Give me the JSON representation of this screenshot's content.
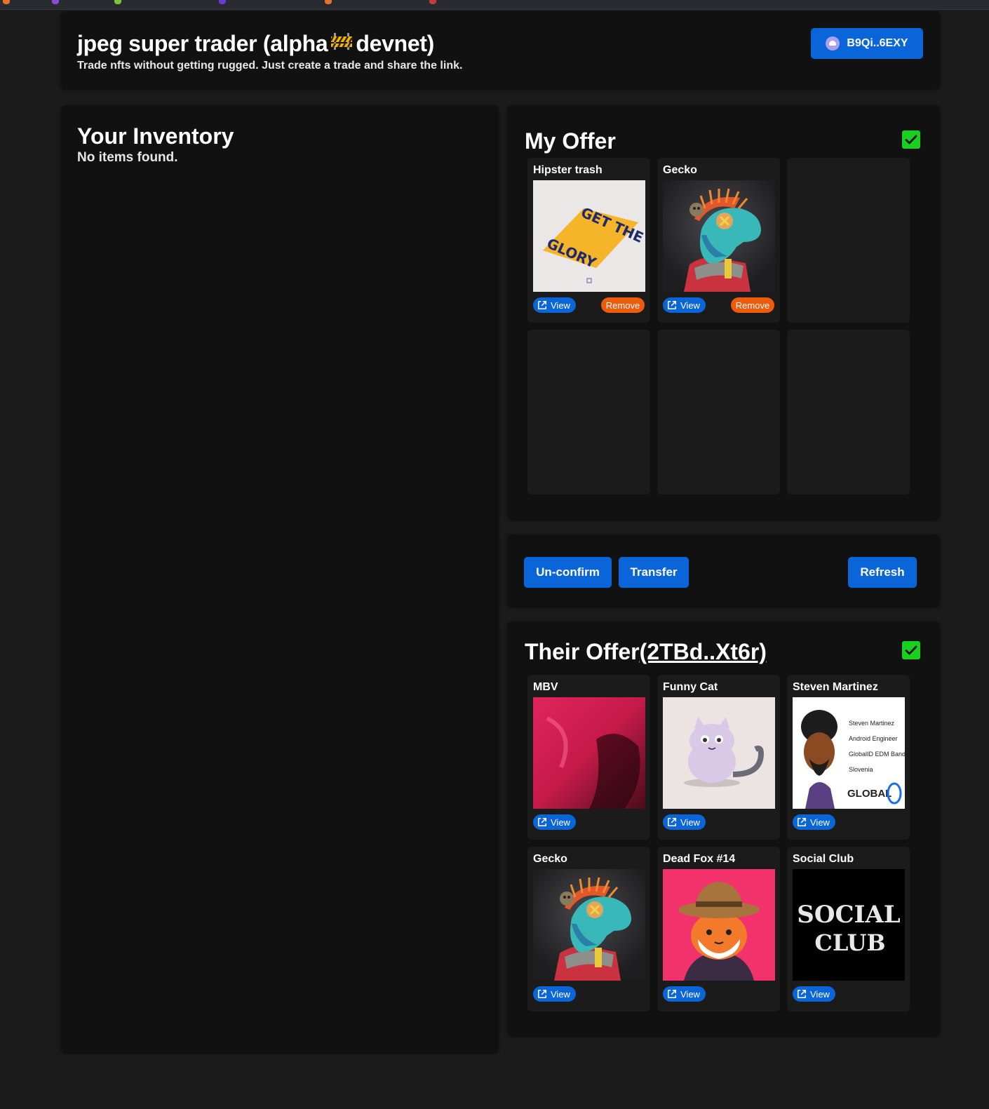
{
  "header": {
    "title_prefix": "jpeg super trader (alpha",
    "title_suffix": "devnet)",
    "subtitle": "Trade nfts without getting rugged. Just create a trade and share the link.",
    "wallet_label": "B9Qi..6EXY"
  },
  "inventory": {
    "title": "Your Inventory",
    "empty_text": "No items found."
  },
  "my_offer": {
    "title": "My Offer",
    "confirmed": true,
    "items": [
      {
        "name": "Hipster trash",
        "view_label": "View",
        "remove_label": "Remove"
      },
      {
        "name": "Gecko",
        "view_label": "View",
        "remove_label": "Remove"
      }
    ]
  },
  "actions": {
    "unconfirm_label": "Un-confirm",
    "transfer_label": "Transfer",
    "refresh_label": "Refresh"
  },
  "their_offer": {
    "title": "Their Offer",
    "address": "(2TBd..Xt6r)",
    "confirmed": true,
    "items": [
      {
        "name": "MBV",
        "view_label": "View"
      },
      {
        "name": "Funny Cat",
        "view_label": "View"
      },
      {
        "name": "Steven Martinez",
        "view_label": "View"
      },
      {
        "name": "Gecko",
        "view_label": "View"
      },
      {
        "name": "Dead Fox #14",
        "view_label": "View"
      },
      {
        "name": "Social Club",
        "view_label": "View"
      }
    ]
  },
  "artwork_text": {
    "glory_top": "GET THE",
    "glory_bottom": "GLORY",
    "steven_lines": [
      "Steven Martinez",
      "Android Engineer",
      "GlobalID EDM Band",
      "Slovenia"
    ],
    "global_id": "GLOBAL",
    "social_top": "SOCIAL",
    "social_bottom": "CLUB"
  },
  "colors": {
    "accent": "#0a66d8",
    "remove": "#ef5b0c",
    "confirm": "#19d01f",
    "panel": "#111112",
    "background": "#1b1b1c"
  }
}
